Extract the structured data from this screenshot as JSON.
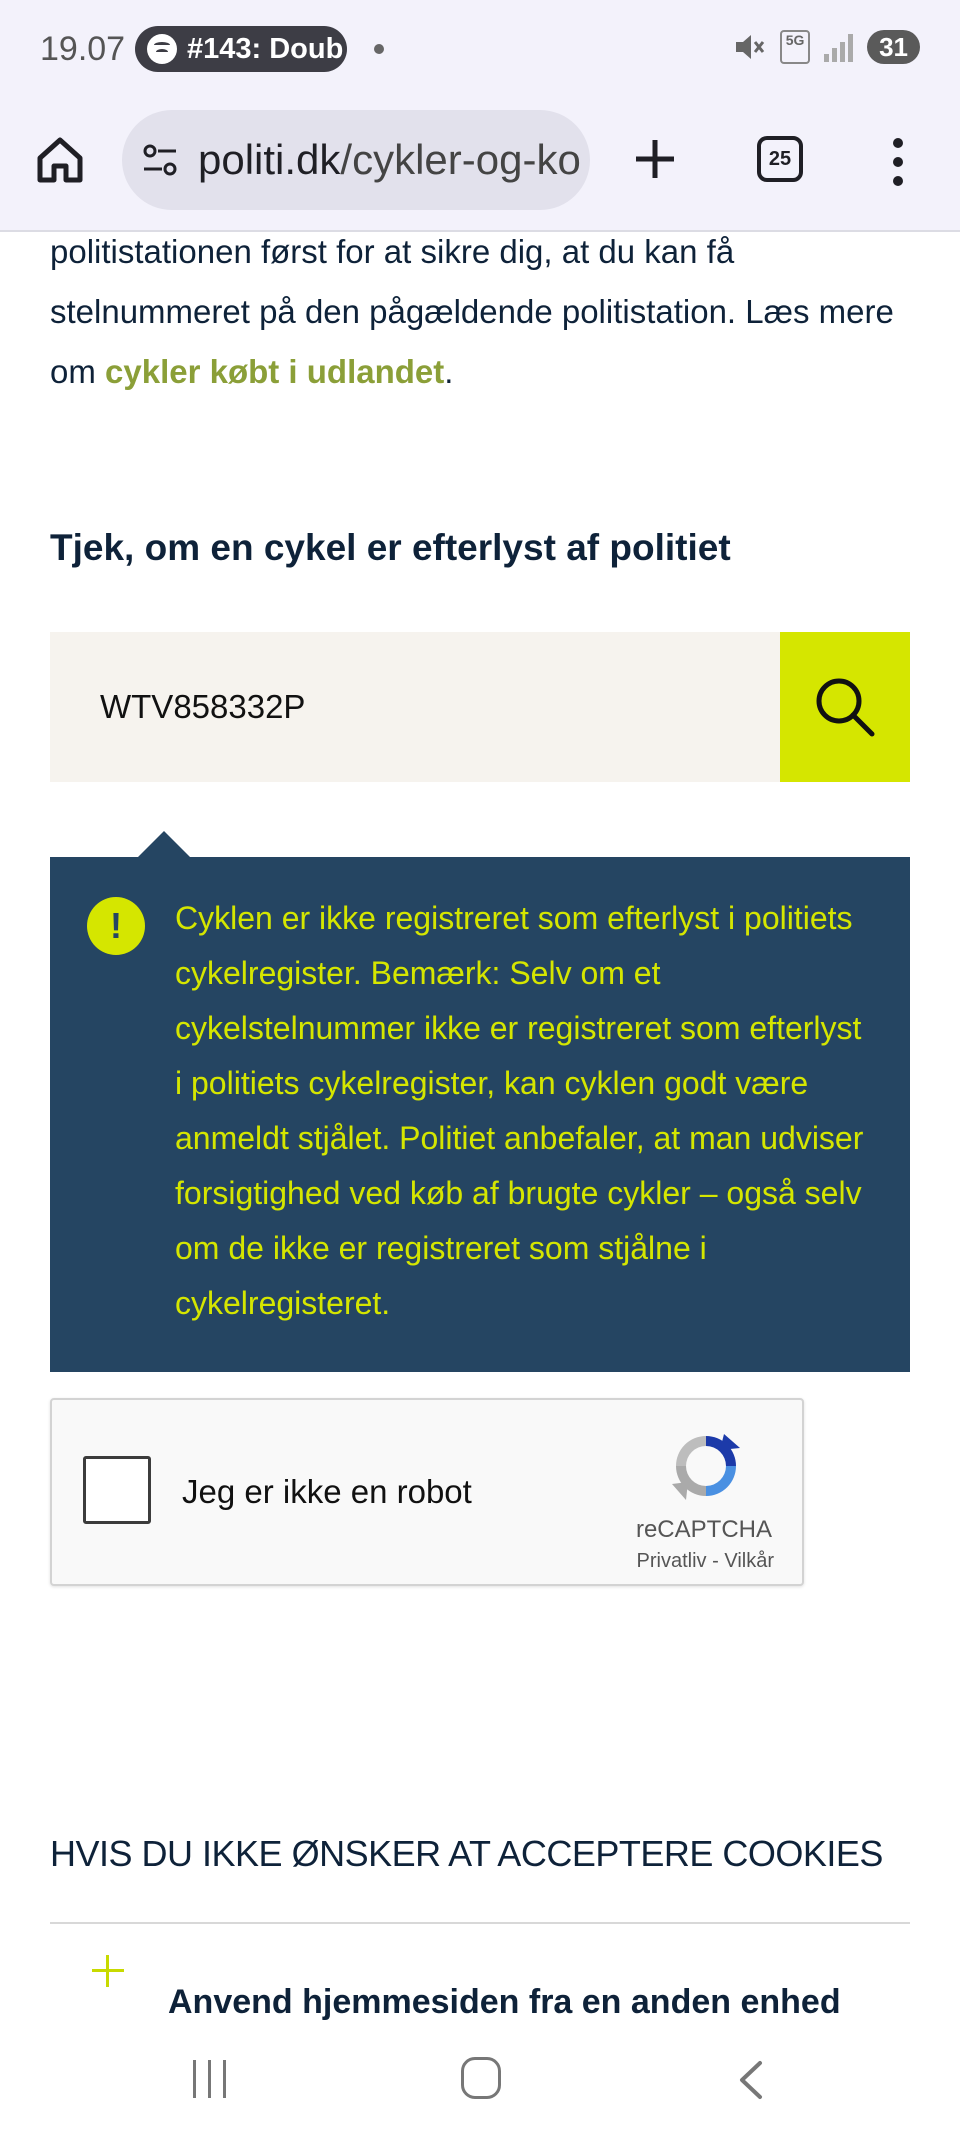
{
  "status_bar": {
    "time": "19.07",
    "media_pill": "#143: Doub",
    "network": "5G",
    "battery": "31"
  },
  "browser": {
    "url_domain": "politi.dk",
    "url_path": "/cykler-og-ko",
    "tab_count": "25"
  },
  "content": {
    "intro_text_before": "politistationen først for at sikre dig, at du kan få stelnummeret på den pågældende politistation. Læs mere om ",
    "intro_link": "cykler købt i udlandet",
    "intro_text_after": ".",
    "section_title": "Tjek, om en cykel er efterlyst af politiet",
    "search": {
      "value": "WTV858332P",
      "placeholder": ""
    },
    "notice": {
      "icon": "!",
      "text": "Cyklen er ikke registreret som efterlyst i politiets cykelregister. Bemærk: Selv om et cykelstelnummer ikke er registreret som efterlyst i politiets cykelregister, kan cyklen godt være anmeldt stjålet. Politiet anbefaler, at man udviser forsigtighed ved køb af brugte cykler – også selv om de ikke er registreret som stjålne i cykelregisteret."
    },
    "captcha": {
      "label": "Jeg er ikke en robot",
      "brand": "reCAPTCHA",
      "privacy": "Privatliv",
      "separator": " - ",
      "terms": "Vilkår"
    },
    "cookies_title": "HVIS DU IKKE ØNSKER AT ACCEPTERE COOKIES",
    "accordion_item": "Anvend hjemmesiden fra en anden enhed"
  },
  "colors": {
    "navy": "#0e2239",
    "notice_bg": "#254562",
    "accent_lime": "#d5e600",
    "link_olive": "#8b9f38",
    "search_bg": "#f6f3ee"
  },
  "icons": [
    "spotify-icon",
    "mute-icon",
    "signal-icon",
    "home-icon",
    "site-settings-icon",
    "plus-icon",
    "tabs-icon",
    "more-icon",
    "search-icon",
    "warning-icon",
    "recaptcha-logo-icon",
    "expand-plus-icon",
    "nav-recents-icon",
    "nav-home-icon",
    "nav-back-icon"
  ]
}
